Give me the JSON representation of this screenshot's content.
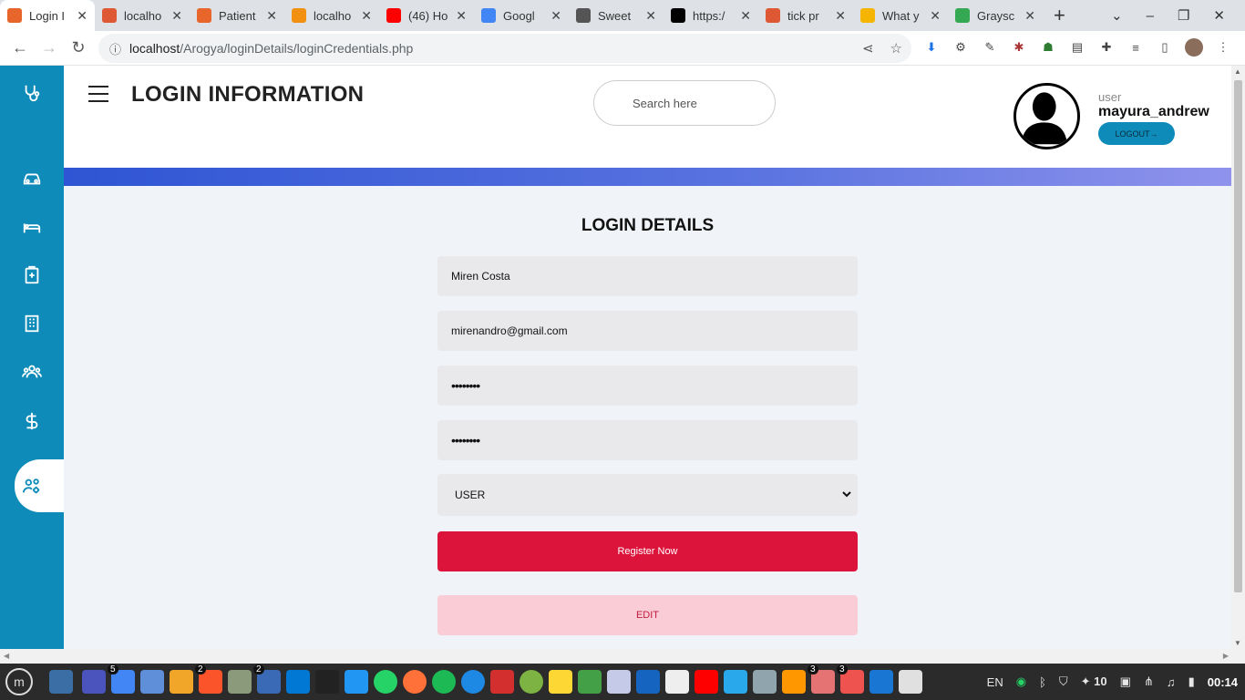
{
  "browser": {
    "tabs": [
      {
        "title": "Login I",
        "favicon_color": "#e8652b",
        "active": true
      },
      {
        "title": "localho",
        "favicon_color": "#de5833",
        "active": false
      },
      {
        "title": "Patient",
        "favicon_color": "#e8652b",
        "active": false
      },
      {
        "title": "localho",
        "favicon_color": "#f29111",
        "active": false
      },
      {
        "title": "(46) Ho",
        "favicon_color": "#ff0000",
        "active": false
      },
      {
        "title": "Googl",
        "favicon_color": "#4285f4",
        "active": false
      },
      {
        "title": "Sweet",
        "favicon_color": "#555555",
        "active": false
      },
      {
        "title": "https:/",
        "favicon_color": "#000000",
        "active": false
      },
      {
        "title": "tick pr",
        "favicon_color": "#de5833",
        "active": false
      },
      {
        "title": "What y",
        "favicon_color": "#f4b400",
        "active": false
      },
      {
        "title": "Graysc",
        "favicon_color": "#34a853",
        "active": false
      }
    ],
    "url_host": "localhost",
    "url_path": "/Arogya/loginDetails/loginCredentials.php"
  },
  "header": {
    "title": "LOGIN INFORMATION",
    "search_placeholder": "Search here",
    "user_role": "user",
    "user_name": "mayura_andrew",
    "logout_label": "LOGOUT→"
  },
  "form": {
    "title": "LOGIN DETAILS",
    "name_value": "Miren Costa",
    "email_value": "mirenandro@gmail.com",
    "password_value": "••••••••",
    "confirm_password_value": "••••••••",
    "role_selected": "USER",
    "register_label": "Register Now",
    "edit_label": "EDIT"
  },
  "colors": {
    "sidebar": "#0e8bb8",
    "register_button": "#dc143c",
    "edit_button": "#f9ccd6",
    "gradient_start": "#2f55d4",
    "gradient_end": "#8f93ec"
  },
  "sidebar_icons": [
    "stethoscope-icon",
    "car-icon",
    "bed-icon",
    "clipboard-icon",
    "hospital-icon",
    "group-icon",
    "dollar-icon",
    "users-cog-icon"
  ],
  "taskbar": {
    "badges": {
      "chrome": "5",
      "brave": "2",
      "editor": "2",
      "photos": "3",
      "glasses": "3"
    },
    "tray": {
      "language": "EN",
      "brightness": "10",
      "time": "00:14"
    }
  }
}
